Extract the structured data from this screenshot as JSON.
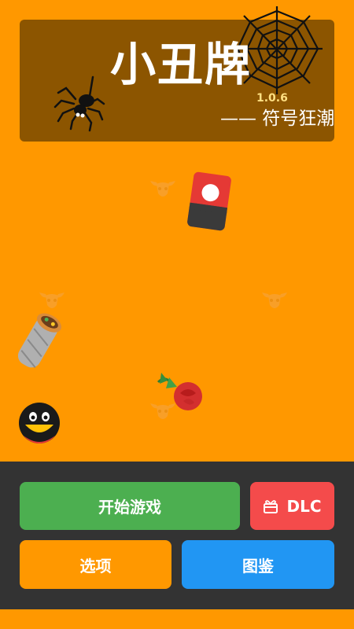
{
  "header": {
    "title": "小丑牌",
    "version": "1.0.6",
    "subtitle": "—— 符号狂潮"
  },
  "icons": {
    "web": "spider-web-icon",
    "spider": "spider-icon",
    "skull": "bull-skull-icon",
    "card": "red-card-icon",
    "burrito": "burrito-icon",
    "rose": "rose-icon",
    "face": "black-emoji-face-icon",
    "dlc": "gift-icon"
  },
  "menu": {
    "start_label": "开始游戏",
    "dlc_label": "DLC",
    "options_label": "选项",
    "gallery_label": "图鉴"
  },
  "colors": {
    "background": "#ff9800",
    "title_panel": "#8c5500",
    "bottom_bar": "#333333",
    "start": "#4caf50",
    "dlc": "#f44b4b",
    "options": "#ff9800",
    "gallery": "#2196f3"
  }
}
